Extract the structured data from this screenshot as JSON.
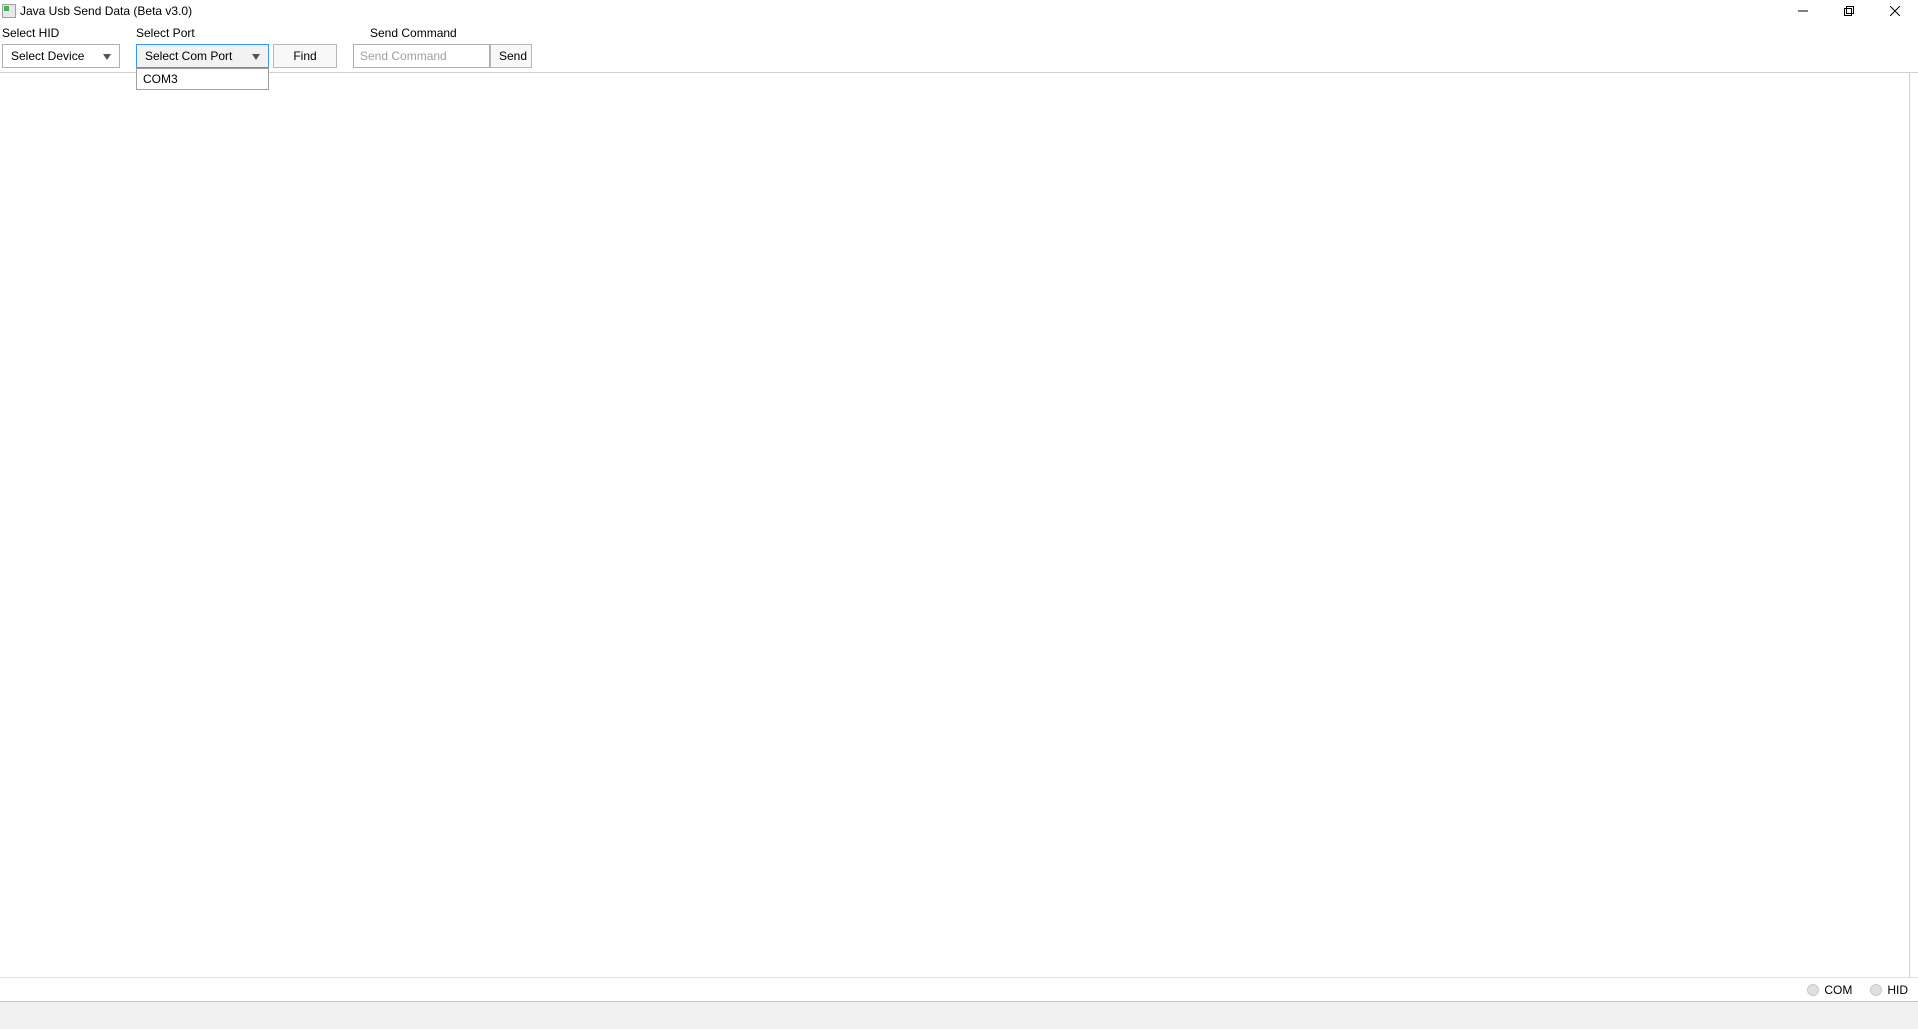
{
  "window": {
    "title": "Java Usb Send Data (Beta v3.0)"
  },
  "labels": {
    "select_hid": "Select HID",
    "select_port": "Select Port",
    "send_command": "Send Command"
  },
  "combos": {
    "hid": {
      "selected": "Select Device"
    },
    "port": {
      "selected": "Select Com Port",
      "options": [
        "COM3"
      ]
    }
  },
  "buttons": {
    "find": "Find",
    "send": "Send"
  },
  "inputs": {
    "command_placeholder": "Send Command",
    "command_value": ""
  },
  "status": {
    "com_label": "COM",
    "hid_label": "HID"
  }
}
